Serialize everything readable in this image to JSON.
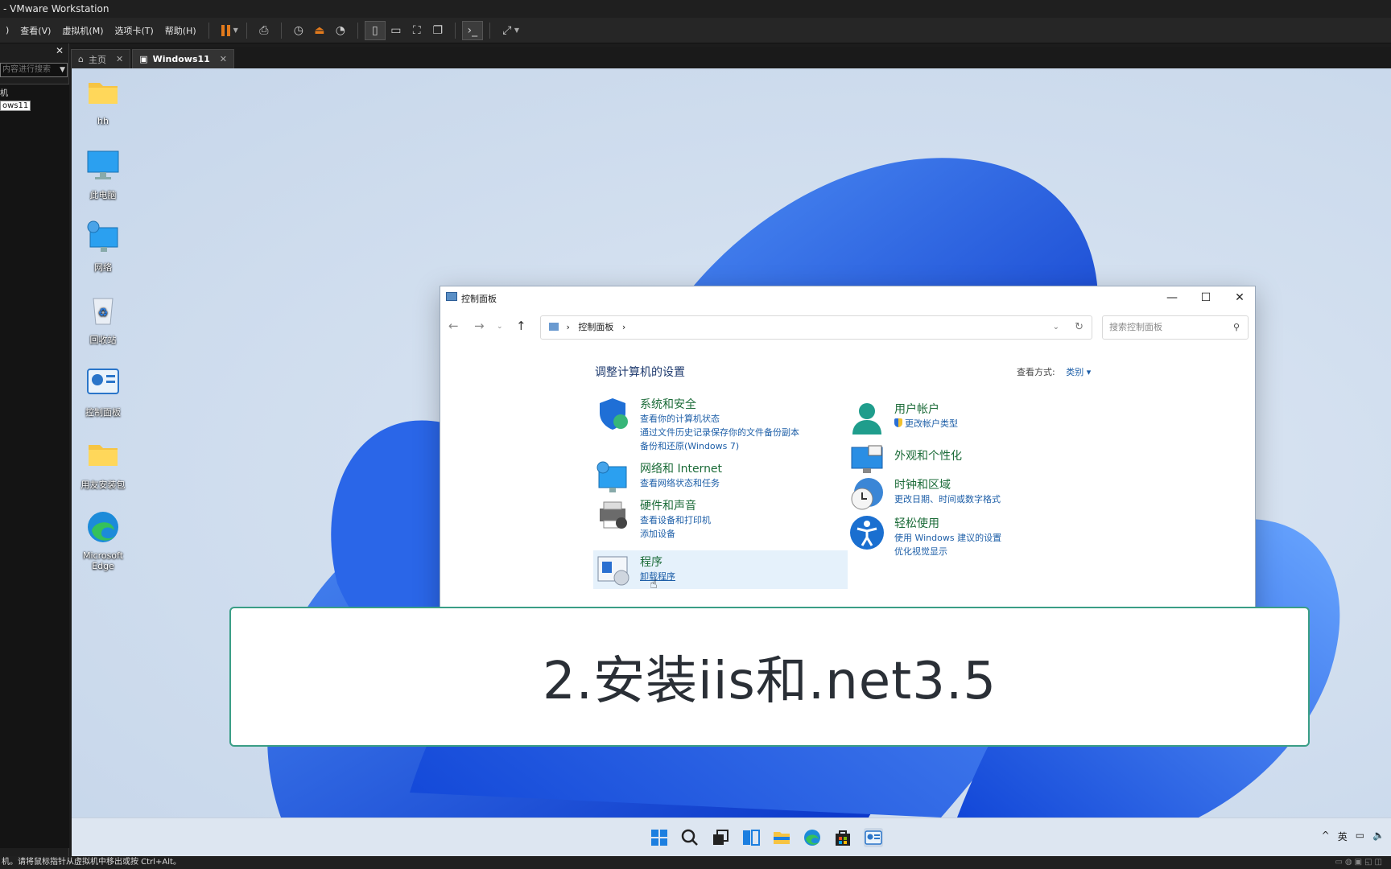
{
  "app": {
    "title": "- VMware Workstation"
  },
  "menu": [
    "查看(V)",
    "虚拟机(M)",
    "选项卡(T)",
    "帮助(H)"
  ],
  "toolbar": {
    "icons": [
      "pause-icon",
      "send-keys-icon",
      "snapshot-icon",
      "revert-snapshot-icon",
      "snapshot-manager-icon",
      "library-view-icon",
      "thumbnail-view-icon",
      "fullscreen-icon",
      "unity-icon",
      "console-icon",
      "stretch-icon"
    ]
  },
  "library": {
    "search_placeholder": "内容进行搜索",
    "node1": "机",
    "node2": "ows11"
  },
  "tabs": [
    {
      "label": "主页",
      "icon": "home-icon"
    },
    {
      "label": "Windows11",
      "icon": "vm-icon"
    }
  ],
  "desktop_icons": [
    {
      "label": "hh",
      "icon": "folder-icon"
    },
    {
      "label": "此电脑",
      "icon": "computer-icon"
    },
    {
      "label": "网络",
      "icon": "network-icon"
    },
    {
      "label": "回收站",
      "icon": "recycle-bin-icon"
    },
    {
      "label": "控制面板",
      "icon": "control-panel-icon"
    },
    {
      "label": "用友安装包",
      "icon": "folder-icon"
    },
    {
      "label": "Microsoft Edge",
      "icon": "edge-icon"
    }
  ],
  "control_panel": {
    "window_title": "控制面板",
    "address": "控制面板",
    "search_placeholder": "搜索控制面板",
    "heading": "调整计算机的设置",
    "view_label": "查看方式:",
    "view_value": "类别 ▾",
    "categories": [
      {
        "title": "系统和安全",
        "links": [
          "查看你的计算机状态",
          "通过文件历史记录保存你的文件备份副本",
          "备份和还原(Windows 7)"
        ]
      },
      {
        "title": "网络和 Internet",
        "links": [
          "查看网络状态和任务"
        ]
      },
      {
        "title": "硬件和声音",
        "links": [
          "查看设备和打印机",
          "添加设备"
        ]
      },
      {
        "title": "程序",
        "links": [
          "卸载程序"
        ]
      },
      {
        "title": "用户帐户",
        "links": [
          "更改帐户类型"
        ]
      },
      {
        "title": "外观和个性化",
        "links": []
      },
      {
        "title": "时钟和区域",
        "links": [
          "更改日期、时间或数字格式"
        ]
      },
      {
        "title": "轻松使用",
        "links": [
          "使用 Windows 建议的设置",
          "优化视觉显示"
        ]
      }
    ]
  },
  "taskbar": {
    "apps": [
      "start-icon",
      "search-icon",
      "task-view-icon",
      "widgets-icon",
      "file-explorer-icon",
      "edge-icon",
      "store-icon",
      "control-panel-icon"
    ],
    "tray": {
      "chevron": "^",
      "ime": "英"
    }
  },
  "statusbar": {
    "text": "机。请将鼠标指针从虚拟机中移出或按 Ctrl+Alt。"
  },
  "caption": "2.安装iis和.net3.5",
  "colors": {
    "accent": "#1e5fa8",
    "category_green": "#1b6b38",
    "caption_border": "#3a9e86",
    "pause_orange": "#e27a1c"
  }
}
